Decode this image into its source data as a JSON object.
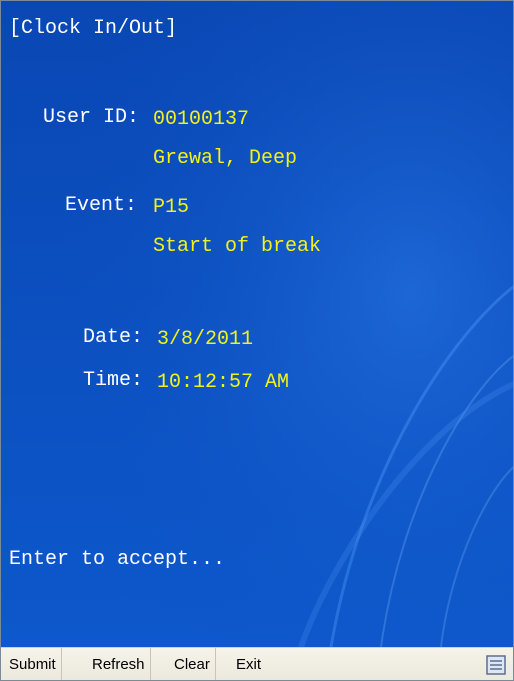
{
  "screen": {
    "title": "[Clock In/Out]",
    "user_id_label": "User ID:",
    "user_id_value": "00100137",
    "user_name": "Grewal, Deep",
    "event_label": "Event:",
    "event_code": "P15",
    "event_description": "Start of break",
    "date_label": "Date:",
    "date_value": "3/8/2011",
    "time_label": "Time:",
    "time_value": "10:12:57 AM",
    "prompt": "Enter to accept..."
  },
  "menubar": {
    "items": [
      {
        "label": "Submit"
      },
      {
        "label": "Refresh"
      },
      {
        "label": "Clear"
      },
      {
        "label": "Exit"
      }
    ],
    "keyboard_icon": "keyboard-toggle-icon"
  },
  "colors": {
    "background": "#0b4fc0",
    "label_text": "#ffffff",
    "value_text": "#f2f21a",
    "menubar": "#efece1"
  }
}
